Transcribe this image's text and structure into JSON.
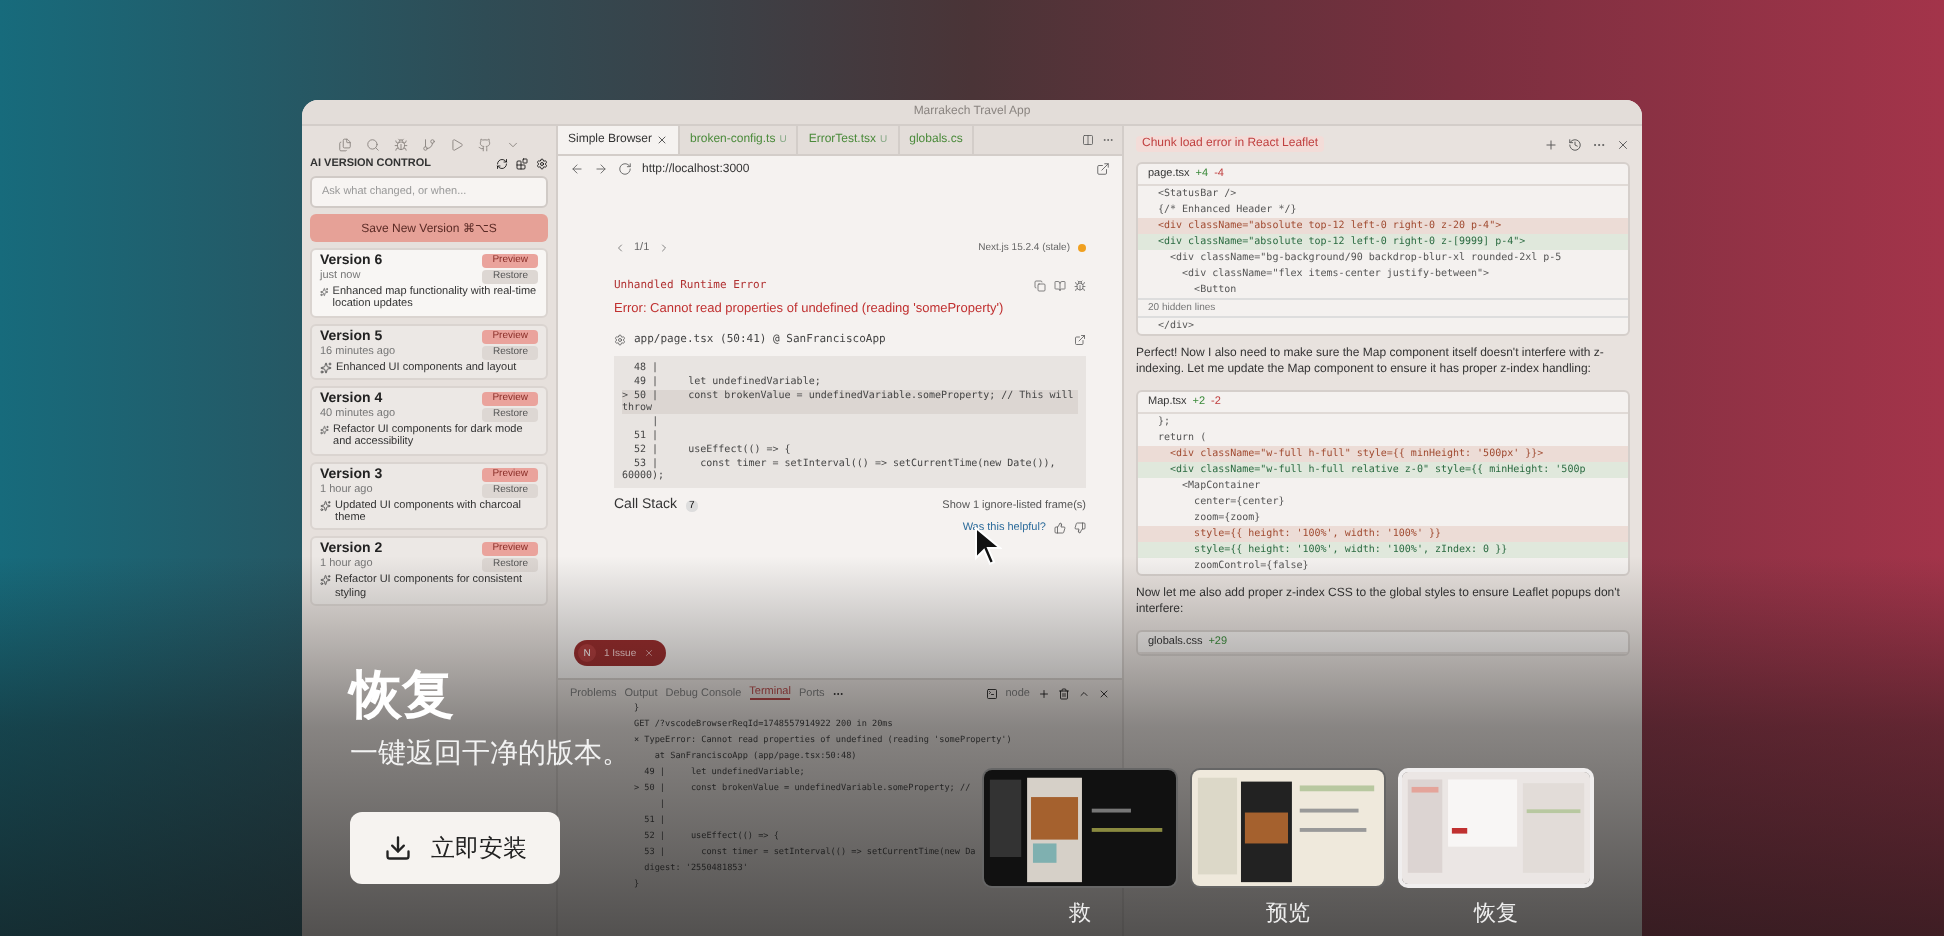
{
  "window": {
    "title": "Marrakech Travel App"
  },
  "sidebar": {
    "title": "AI VERSION CONTROL",
    "search": {
      "placeholder": "Ask what changed, or when..."
    },
    "save_button": "Save New Version ⌘⌥S",
    "versions": [
      {
        "name": "Version 6",
        "time": "just now",
        "preview": "Preview",
        "restore": "Restore",
        "note": "Enhanced map functionality with real-time location updates",
        "selected": true
      },
      {
        "name": "Version 5",
        "time": "16 minutes ago",
        "preview": "Preview",
        "restore": "Restore",
        "note": "Enhanced UI components and layout",
        "selected": false
      },
      {
        "name": "Version 4",
        "time": "40 minutes ago",
        "preview": "Preview",
        "restore": "Restore",
        "note": "Refactor UI components for dark mode and accessibility",
        "selected": false
      },
      {
        "name": "Version 3",
        "time": "1 hour ago",
        "preview": "Preview",
        "restore": "Restore",
        "note": "Updated UI components with charcoal theme",
        "selected": false
      },
      {
        "name": "Version 2",
        "time": "1 hour ago",
        "preview": "Preview",
        "restore": "Restore",
        "note": "Refactor UI components for consistent styling",
        "selected": false
      }
    ]
  },
  "browser": {
    "tabs": [
      {
        "label": "Simple Browser",
        "selected": true
      },
      {
        "label": "broken-config.ts",
        "modifier": "U",
        "selected": false
      },
      {
        "label": "ErrorTest.tsx",
        "modifier": "U",
        "selected": false
      },
      {
        "label": "globals.cs",
        "selected": false
      }
    ],
    "url": "http://localhost:3000",
    "error": {
      "pager": "1/1",
      "version": "Next.js 15.2.4 (stale)",
      "heading": "Unhandled Runtime Error",
      "message": "Error: Cannot read properties of undefined (reading 'someProperty')",
      "file": "app/page.tsx (50:41) @ SanFranciscoApp",
      "code": [
        {
          "text": "  48 |",
          "highlight": false
        },
        {
          "text": "  49 |     let undefinedVariable;",
          "highlight": false
        },
        {
          "text": "> 50 |     const brokenValue = undefinedVariable.someProperty; // This will throw",
          "highlight": true
        },
        {
          "text": "     |",
          "highlight": false
        },
        {
          "text": "  51 |",
          "highlight": false
        },
        {
          "text": "  52 |     useEffect(() => {",
          "highlight": false
        },
        {
          "text": "  53 |       const timer = setInterval(() => setCurrentTime(new Date()), 60000);",
          "highlight": false
        }
      ],
      "call_stack": "Call Stack",
      "call_stack_count": "7",
      "ignore_listed": "Show 1 ignore-listed frame(s)",
      "feedback": "Was this helpful?"
    },
    "issue_badge": {
      "letter": "N",
      "label": "1 Issue"
    }
  },
  "terminal": {
    "tabs": [
      {
        "label": "Problems",
        "selected": false
      },
      {
        "label": "Output",
        "selected": false
      },
      {
        "label": "Debug Console",
        "selected": false
      },
      {
        "label": "Terminal",
        "selected": true
      },
      {
        "label": "Ports",
        "selected": false
      }
    ],
    "shell": "node",
    "lines": [
      "}",
      "GET /?vscodeBrowserReqId=1748557914922 200 in 20ms",
      "⨯ TypeError: Cannot read properties of undefined (reading 'someProperty')",
      "    at SanFranciscoApp (app/page.tsx:50:48)",
      "  49 |     let undefinedVariable;",
      "> 50 |     const brokenValue = undefinedVariable.someProperty; //",
      "     |",
      "  51 |",
      "  52 |     useEffect(() => {",
      "  53 |       const timer = setInterval(() => setCurrentTime(new Da",
      "  digest: '2550481853'",
      "}"
    ]
  },
  "chat": {
    "title": "Chunk load error in React Leaflet",
    "blocks": [
      {
        "kind": "code",
        "file": "page.tsx",
        "added": "+4",
        "removed": "-4",
        "lines": [
          {
            "text": "<StatusBar />",
            "kind": "plain"
          },
          {
            "text": "{/* Enhanced Header */}",
            "kind": "plain"
          },
          {
            "text": "<div className=\"absolute top-12 left-0 right-0 z-20 p-4\">",
            "kind": "removed"
          },
          {
            "text": "<div className=\"absolute top-12 left-0 right-0 z-[9999] p-4\">",
            "kind": "added"
          },
          {
            "text": "  <div className=\"bg-background/90 backdrop-blur-xl rounded-2xl p-5",
            "kind": "plain"
          },
          {
            "text": "    <div className=\"flex items-center justify-between\">",
            "kind": "plain"
          },
          {
            "text": "      <Button",
            "kind": "plain"
          }
        ],
        "hidden": "20 hidden lines",
        "after": [
          "</div>"
        ]
      },
      {
        "kind": "text",
        "text": "Perfect! Now I also need to make sure the Map component itself doesn't interfere with z-indexing. Let me update the Map component to ensure it has proper z-index handling:"
      },
      {
        "kind": "code",
        "file": "Map.tsx",
        "added": "+2",
        "removed": "-2",
        "lines": [
          {
            "text": "};",
            "kind": "plain"
          },
          {
            "text": "return (",
            "kind": "plain"
          },
          {
            "text": "  <div className=\"w-full h-full\" style={{ minHeight: '500px' }}>",
            "kind": "removed"
          },
          {
            "text": "  <div className=\"w-full h-full relative z-0\" style={{ minHeight: '500p",
            "kind": "added"
          },
          {
            "text": "    <MapContainer",
            "kind": "plain"
          },
          {
            "text": "      center={center}",
            "kind": "plain"
          },
          {
            "text": "      zoom={zoom}",
            "kind": "plain"
          },
          {
            "text": "      style={{ height: '100%', width: '100%' }}",
            "kind": "removed"
          },
          {
            "text": "      style={{ height: '100%', width: '100%', zIndex: 0 }}",
            "kind": "added"
          },
          {
            "text": "      zoomControl={false}",
            "kind": "plain"
          }
        ]
      },
      {
        "kind": "text",
        "text": "Now let me also add proper z-index CSS to the global styles to ensure Leaflet popups don't interfere:"
      },
      {
        "kind": "code",
        "file": "globals.css",
        "added": "+29"
      }
    ]
  },
  "hero": {
    "title": "恢复",
    "subtitle": "一键返回干净的版本。",
    "install_button": "立即安装"
  },
  "thumbnails": [
    {
      "label": "救",
      "kind": "dark",
      "selected": false
    },
    {
      "label": "预览",
      "kind": "light",
      "selected": false
    },
    {
      "label": "恢复",
      "kind": "pale",
      "selected": true
    }
  ]
}
